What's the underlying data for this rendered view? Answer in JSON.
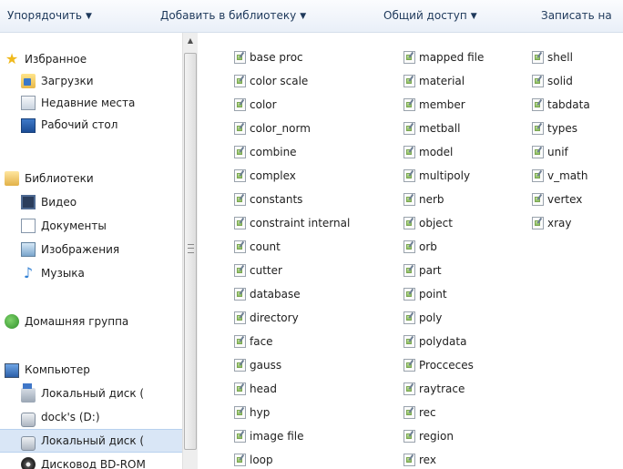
{
  "toolbar": {
    "organize": "Упорядочить",
    "add_to_library": "Добавить в библиотеку",
    "share": "Общий доступ",
    "burn": "Записать на"
  },
  "nav": {
    "favorites": {
      "header": "Избранное",
      "items": [
        "Загрузки",
        "Недавние места",
        "Рабочий стол"
      ]
    },
    "libraries": {
      "header": "Библиотеки",
      "items": [
        "Видео",
        "Документы",
        "Изображения",
        "Музыка"
      ]
    },
    "homegroup": "Домашняя группа",
    "computer": {
      "header": "Компьютер",
      "items": [
        "Локальный диск (",
        "dock's (D:)",
        "Локальный диск (",
        "Дисковод BD-ROM"
      ]
    }
  },
  "files": {
    "col1": [
      "base proc",
      "color scale",
      "color",
      "color_norm",
      "combine",
      "complex",
      "constants",
      "constraint internal",
      "count",
      "cutter",
      "database",
      "directory",
      "face",
      "gauss",
      "head",
      "hyp",
      "image file",
      "loop"
    ],
    "col2": [
      "mapped file",
      "material",
      "member",
      "metball",
      "model",
      "multipoly",
      "nerb",
      "object",
      "orb",
      "part",
      "point",
      "poly",
      "polydata",
      "Procceces",
      "raytrace",
      "rec",
      "region",
      "rex"
    ],
    "col3": [
      "shell",
      "solid",
      "tabdata",
      "types",
      "unif",
      "v_math",
      "vertex",
      "xray"
    ]
  }
}
